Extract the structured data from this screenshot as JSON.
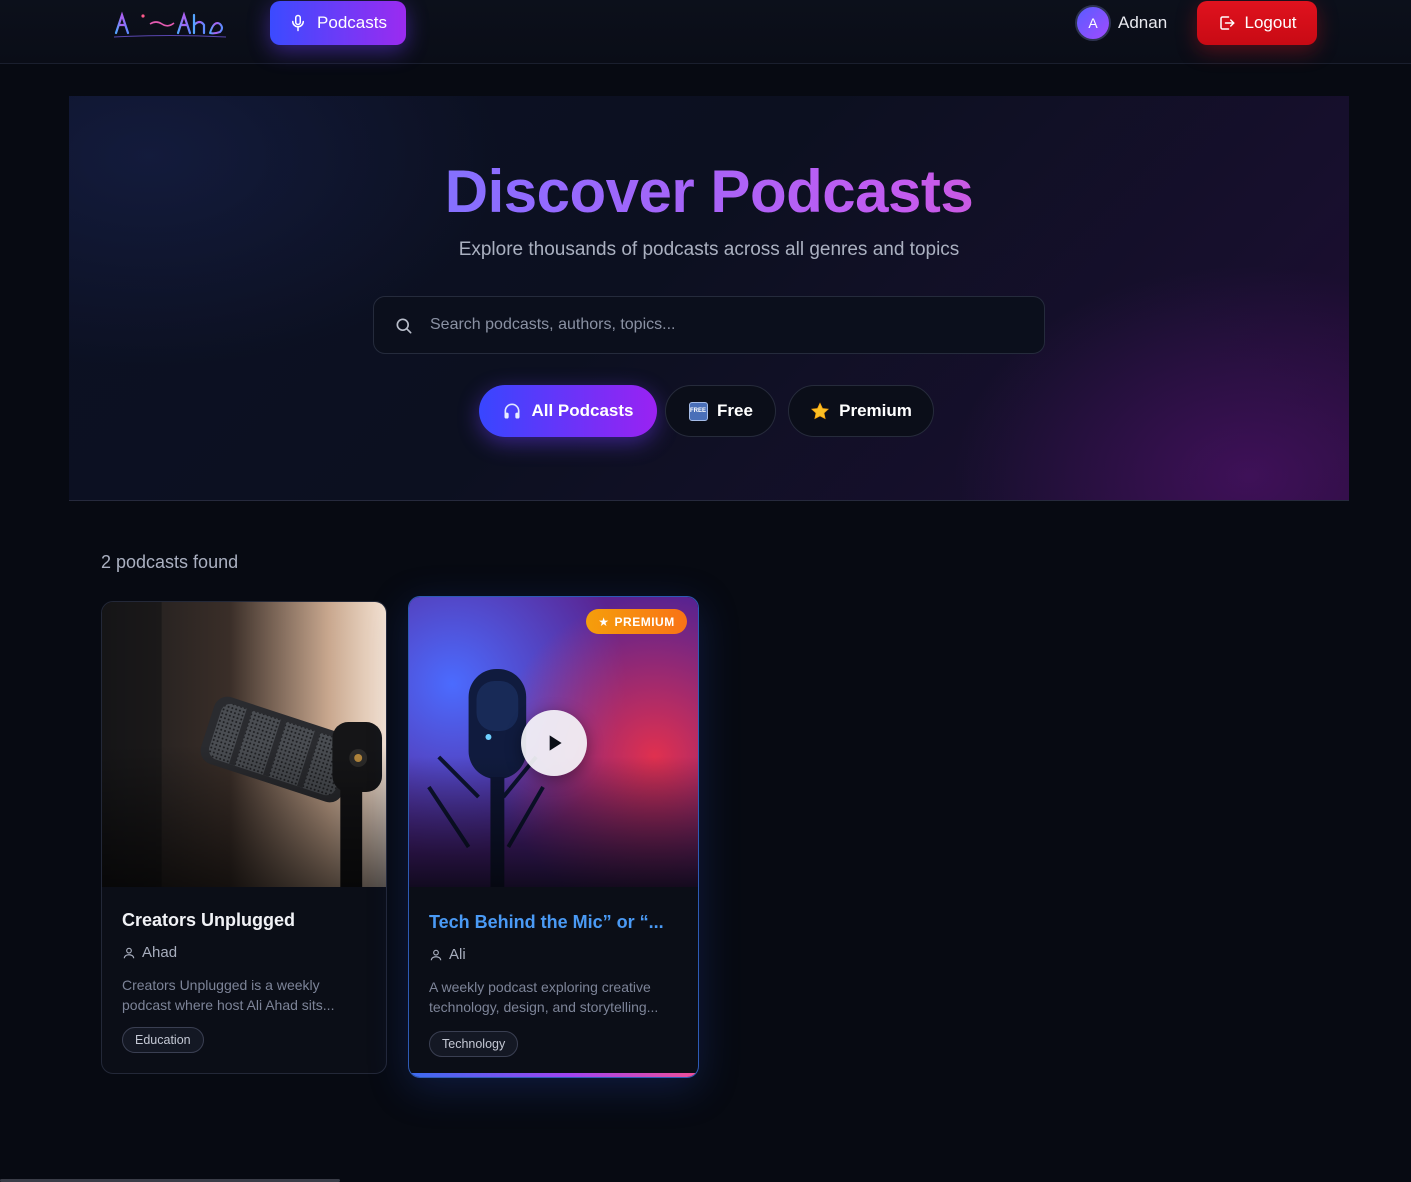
{
  "colors": {
    "accent_gradient_start": "#3b4bff",
    "accent_gradient_end": "#9b2bf0",
    "logout": "#d80e18",
    "premium": "#f59e0b",
    "card_title_active": "#4a9af5",
    "background": "#070a12"
  },
  "navbar": {
    "logo_alt": "Ali Aha",
    "podcasts_label": "Podcasts",
    "podcasts_icon": "microphone-icon",
    "user": {
      "avatar_initial": "A",
      "name": "Adnan"
    },
    "logout_label": "Logout",
    "logout_icon": "logout-icon"
  },
  "hero": {
    "title": "Discover Podcasts",
    "subtitle": "Explore thousands of podcasts across all genres and topics",
    "search": {
      "placeholder": "Search podcasts, authors, topics...",
      "value": "",
      "icon": "search-icon"
    },
    "filters": [
      {
        "label": "All Podcasts",
        "icon": "headphones-icon",
        "active": true
      },
      {
        "label": "Free",
        "icon": "free-icon",
        "active": false
      },
      {
        "label": "Premium",
        "icon": "star-icon",
        "active": false
      }
    ]
  },
  "results": {
    "count_text": "2 podcasts found",
    "cards": [
      {
        "title": "Creators Unplugged",
        "author": "Ahad",
        "description": "Creators Unplugged is a weekly podcast where host Ali Ahad sits...",
        "tag": "Education",
        "premium": false
      },
      {
        "title": "Tech Behind the Mic” or “...",
        "author": "Ali",
        "description": "A weekly podcast exploring creative technology, design, and storytelling...",
        "tag": "Technology",
        "premium": true,
        "premium_label": "PREMIUM"
      }
    ]
  }
}
